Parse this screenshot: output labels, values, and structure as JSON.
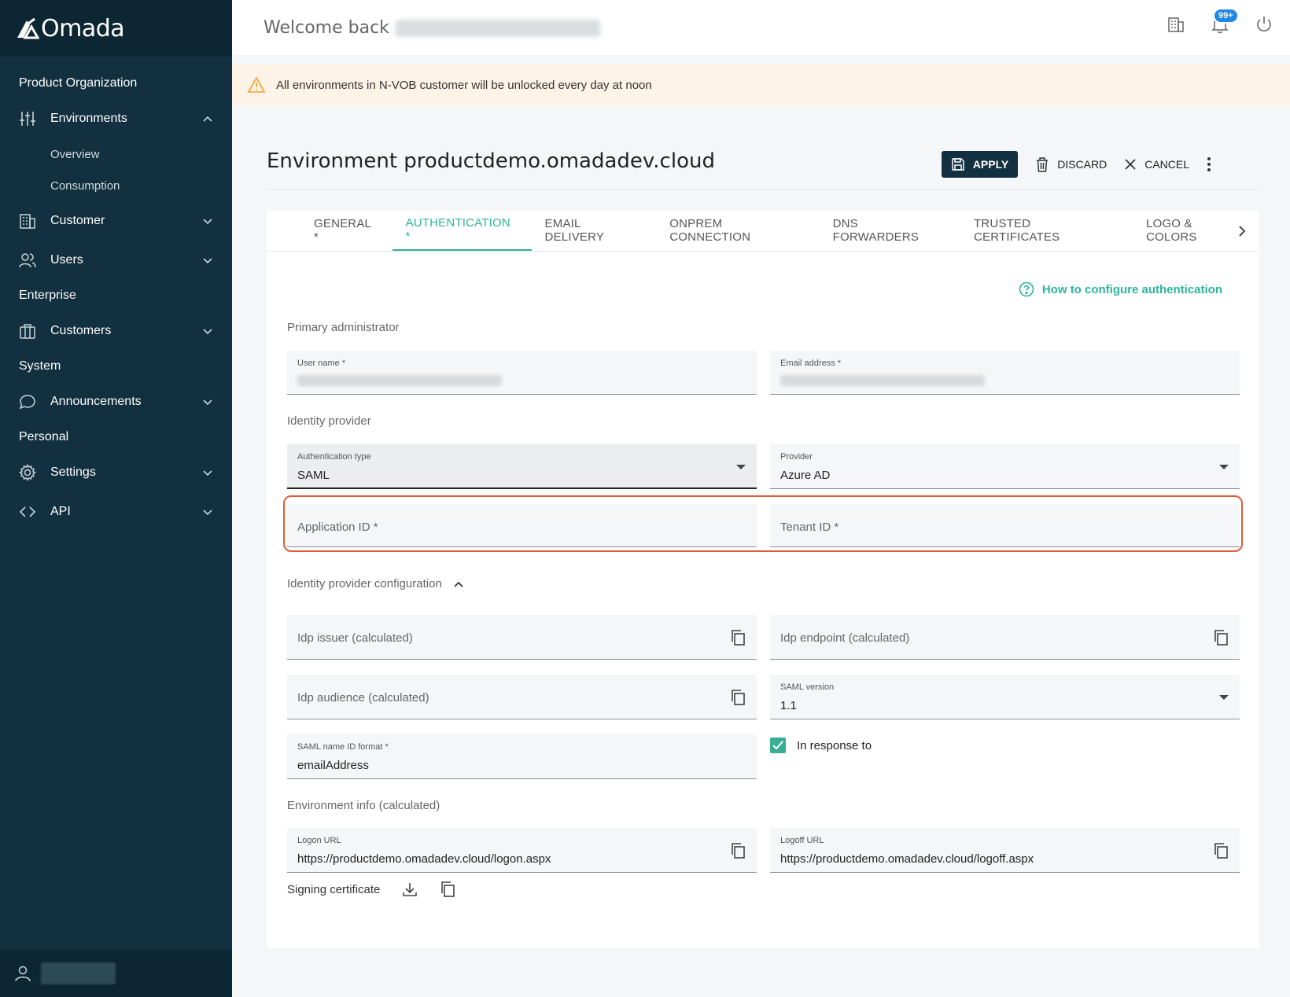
{
  "app": {
    "name": "Omada"
  },
  "sidebar": {
    "sections": [
      {
        "title": "Product Organization"
      },
      {
        "title": "Enterprise"
      },
      {
        "title": "System"
      },
      {
        "title": "Personal"
      }
    ],
    "items": [
      {
        "label": "Environments",
        "icon": "sliders-icon",
        "expanded": true
      },
      {
        "label": "Customer",
        "icon": "building-icon"
      },
      {
        "label": "Users",
        "icon": "users-icon"
      },
      {
        "label": "Customers",
        "icon": "briefcase-icon"
      },
      {
        "label": "Announcements",
        "icon": "chat-bubble-icon"
      },
      {
        "label": "Settings",
        "icon": "gear-icon"
      },
      {
        "label": "API",
        "icon": "code-icon"
      }
    ],
    "subitems": [
      {
        "label": "Overview"
      },
      {
        "label": "Consumption"
      }
    ]
  },
  "topbar": {
    "welcome": "Welcome back",
    "notification_badge": "99+"
  },
  "banner": {
    "text": "All environments in N-VOB customer will be unlocked every day at noon"
  },
  "page": {
    "title": "Environment productdemo.omadadev.cloud",
    "apply_label": "APPLY",
    "discard_label": "DISCARD",
    "cancel_label": "CANCEL"
  },
  "tabs": [
    {
      "label": "GENERAL *"
    },
    {
      "label": "AUTHENTICATION *",
      "active": true
    },
    {
      "label": "EMAIL DELIVERY"
    },
    {
      "label": "ONPREM CONNECTION"
    },
    {
      "label": "DNS FORWARDERS"
    },
    {
      "label": "TRUSTED CERTIFICATES"
    },
    {
      "label": "LOGO & COLORS"
    }
  ],
  "help_link": "How to configure authentication",
  "sections": {
    "primary_admin": "Primary administrator",
    "identity_provider": "Identity provider",
    "idp_config": "Identity provider configuration",
    "env_info": "Environment info (calculated)"
  },
  "fields": {
    "user_name": {
      "label": "User name *"
    },
    "email": {
      "label": "Email address *"
    },
    "auth_type": {
      "label": "Authentication type",
      "value": "SAML"
    },
    "provider": {
      "label": "Provider",
      "value": "Azure AD"
    },
    "application_id": {
      "placeholder": "Application ID *"
    },
    "tenant_id": {
      "placeholder": "Tenant ID *"
    },
    "idp_issuer": {
      "placeholder": "Idp issuer (calculated)"
    },
    "idp_endpoint": {
      "placeholder": "Idp endpoint (calculated)"
    },
    "idp_audience": {
      "placeholder": "Idp audience (calculated)"
    },
    "saml_version": {
      "label": "SAML version",
      "value": "1.1"
    },
    "saml_name_id": {
      "label": "SAML name ID format *",
      "value": "emailAddress"
    },
    "in_response_to": {
      "label": "In response to",
      "checked": true
    },
    "logon_url": {
      "label": "Logon URL",
      "value": "https://productdemo.omadadev.cloud/logon.aspx"
    },
    "logoff_url": {
      "label": "Logoff URL",
      "value": "https://productdemo.omadadev.cloud/logoff.aspx"
    }
  },
  "signing_certificate": "Signing certificate",
  "colors": {
    "accent": "#2bb59b",
    "sidebar": "#12303f",
    "highlight": "#e05a3a"
  }
}
